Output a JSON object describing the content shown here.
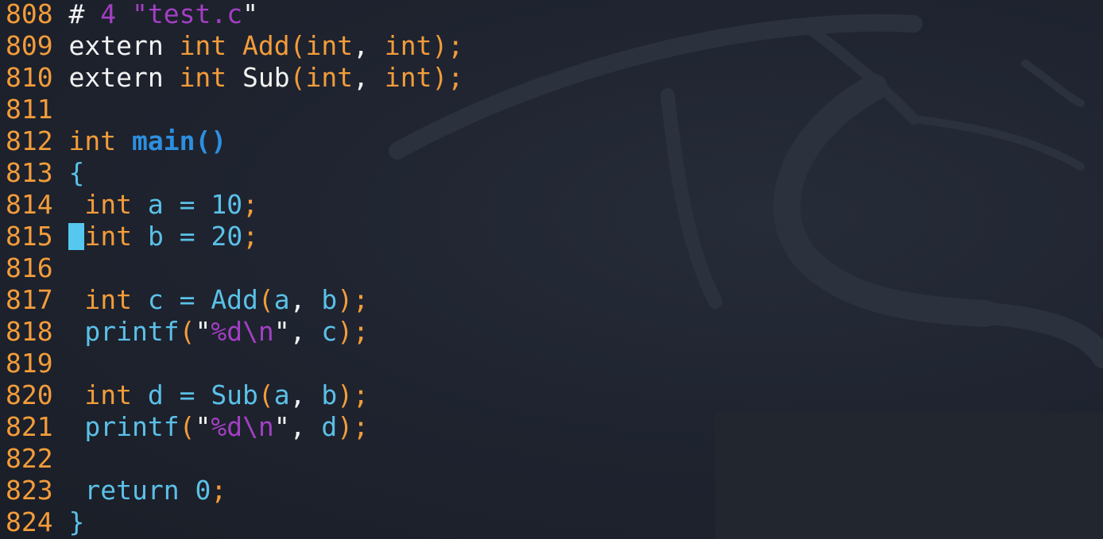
{
  "editor": {
    "file": "test.c",
    "cursor_line": "815",
    "lines": [
      {
        "num": "808",
        "tokens": [
          {
            "t": " ",
            "c": "plain"
          },
          {
            "t": "# ",
            "c": "plain"
          },
          {
            "t": "4 ",
            "c": "purple"
          },
          {
            "t": "\"test.c",
            "c": "purple"
          },
          {
            "t": "\"",
            "c": "plain"
          }
        ]
      },
      {
        "num": "809",
        "tokens": [
          {
            "t": " ",
            "c": "plain"
          },
          {
            "t": "extern ",
            "c": "plain"
          },
          {
            "t": "int ",
            "c": "orange"
          },
          {
            "t": "Add",
            "c": "orange"
          },
          {
            "t": "(",
            "c": "orange"
          },
          {
            "t": "int",
            "c": "orange"
          },
          {
            "t": ", ",
            "c": "plain"
          },
          {
            "t": "int",
            "c": "orange"
          },
          {
            "t": ");",
            "c": "orange"
          }
        ]
      },
      {
        "num": "810",
        "tokens": [
          {
            "t": " ",
            "c": "plain"
          },
          {
            "t": "extern ",
            "c": "plain"
          },
          {
            "t": "int ",
            "c": "orange"
          },
          {
            "t": "Sub",
            "c": "plain"
          },
          {
            "t": "(",
            "c": "orange"
          },
          {
            "t": "int",
            "c": "orange"
          },
          {
            "t": ", ",
            "c": "plain"
          },
          {
            "t": "int",
            "c": "orange"
          },
          {
            "t": ");",
            "c": "orange"
          }
        ]
      },
      {
        "num": "811",
        "tokens": []
      },
      {
        "num": "812",
        "tokens": [
          {
            "t": " ",
            "c": "plain"
          },
          {
            "t": "int ",
            "c": "orange"
          },
          {
            "t": "main()",
            "c": "func"
          }
        ]
      },
      {
        "num": "813",
        "tokens": [
          {
            "t": " ",
            "c": "plain"
          },
          {
            "t": "{",
            "c": "blue"
          }
        ]
      },
      {
        "num": "814",
        "tokens": [
          {
            "t": "  ",
            "c": "plain"
          },
          {
            "t": "int ",
            "c": "orange"
          },
          {
            "t": "a = ",
            "c": "blue"
          },
          {
            "t": "10",
            "c": "blue"
          },
          {
            "t": ";",
            "c": "orange"
          }
        ]
      },
      {
        "num": "815",
        "tokens": [
          {
            "t": " ",
            "c": "plain"
          },
          {
            "t": "CURSOR",
            "c": "cursor"
          },
          {
            "t": "int ",
            "c": "orange"
          },
          {
            "t": "b = ",
            "c": "blue"
          },
          {
            "t": "20",
            "c": "blue"
          },
          {
            "t": ";",
            "c": "orange"
          }
        ]
      },
      {
        "num": "816",
        "tokens": []
      },
      {
        "num": "817",
        "tokens": [
          {
            "t": "  ",
            "c": "plain"
          },
          {
            "t": "int ",
            "c": "orange"
          },
          {
            "t": "c = Add",
            "c": "blue"
          },
          {
            "t": "(",
            "c": "orange"
          },
          {
            "t": "a",
            "c": "blue"
          },
          {
            "t": ", ",
            "c": "plain"
          },
          {
            "t": "b",
            "c": "blue"
          },
          {
            "t": ");",
            "c": "orange"
          }
        ]
      },
      {
        "num": "818",
        "tokens": [
          {
            "t": "  ",
            "c": "plain"
          },
          {
            "t": "printf",
            "c": "blue"
          },
          {
            "t": "(",
            "c": "orange"
          },
          {
            "t": "\"",
            "c": "plain"
          },
          {
            "t": "%d\\n",
            "c": "purple"
          },
          {
            "t": "\", ",
            "c": "plain"
          },
          {
            "t": "c",
            "c": "blue"
          },
          {
            "t": ");",
            "c": "orange"
          }
        ]
      },
      {
        "num": "819",
        "tokens": []
      },
      {
        "num": "820",
        "tokens": [
          {
            "t": "  ",
            "c": "plain"
          },
          {
            "t": "int ",
            "c": "orange"
          },
          {
            "t": "d = Sub",
            "c": "blue"
          },
          {
            "t": "(",
            "c": "orange"
          },
          {
            "t": "a",
            "c": "blue"
          },
          {
            "t": ", ",
            "c": "plain"
          },
          {
            "t": "b",
            "c": "blue"
          },
          {
            "t": ");",
            "c": "orange"
          }
        ]
      },
      {
        "num": "821",
        "tokens": [
          {
            "t": "  ",
            "c": "plain"
          },
          {
            "t": "printf",
            "c": "blue"
          },
          {
            "t": "(",
            "c": "orange"
          },
          {
            "t": "\"",
            "c": "plain"
          },
          {
            "t": "%d\\n",
            "c": "purple"
          },
          {
            "t": "\", ",
            "c": "plain"
          },
          {
            "t": "d",
            "c": "blue"
          },
          {
            "t": ");",
            "c": "orange"
          }
        ]
      },
      {
        "num": "822",
        "tokens": []
      },
      {
        "num": "823",
        "tokens": [
          {
            "t": "  ",
            "c": "plain"
          },
          {
            "t": "return ",
            "c": "blue"
          },
          {
            "t": "0",
            "c": "blue"
          },
          {
            "t": ";",
            "c": "orange"
          }
        ]
      },
      {
        "num": "824",
        "tokens": [
          {
            "t": " ",
            "c": "plain"
          },
          {
            "t": "}",
            "c": "blue"
          }
        ]
      }
    ]
  },
  "colors": {
    "background": "#1d222c",
    "line_number": "#f39c3a",
    "keyword": "#f39c3a",
    "identifier": "#5bc0e8",
    "string": "#a33fc4",
    "function_name": "#2d8fe0",
    "plain": "#f2f2f2",
    "cursor": "#56c8f0"
  }
}
